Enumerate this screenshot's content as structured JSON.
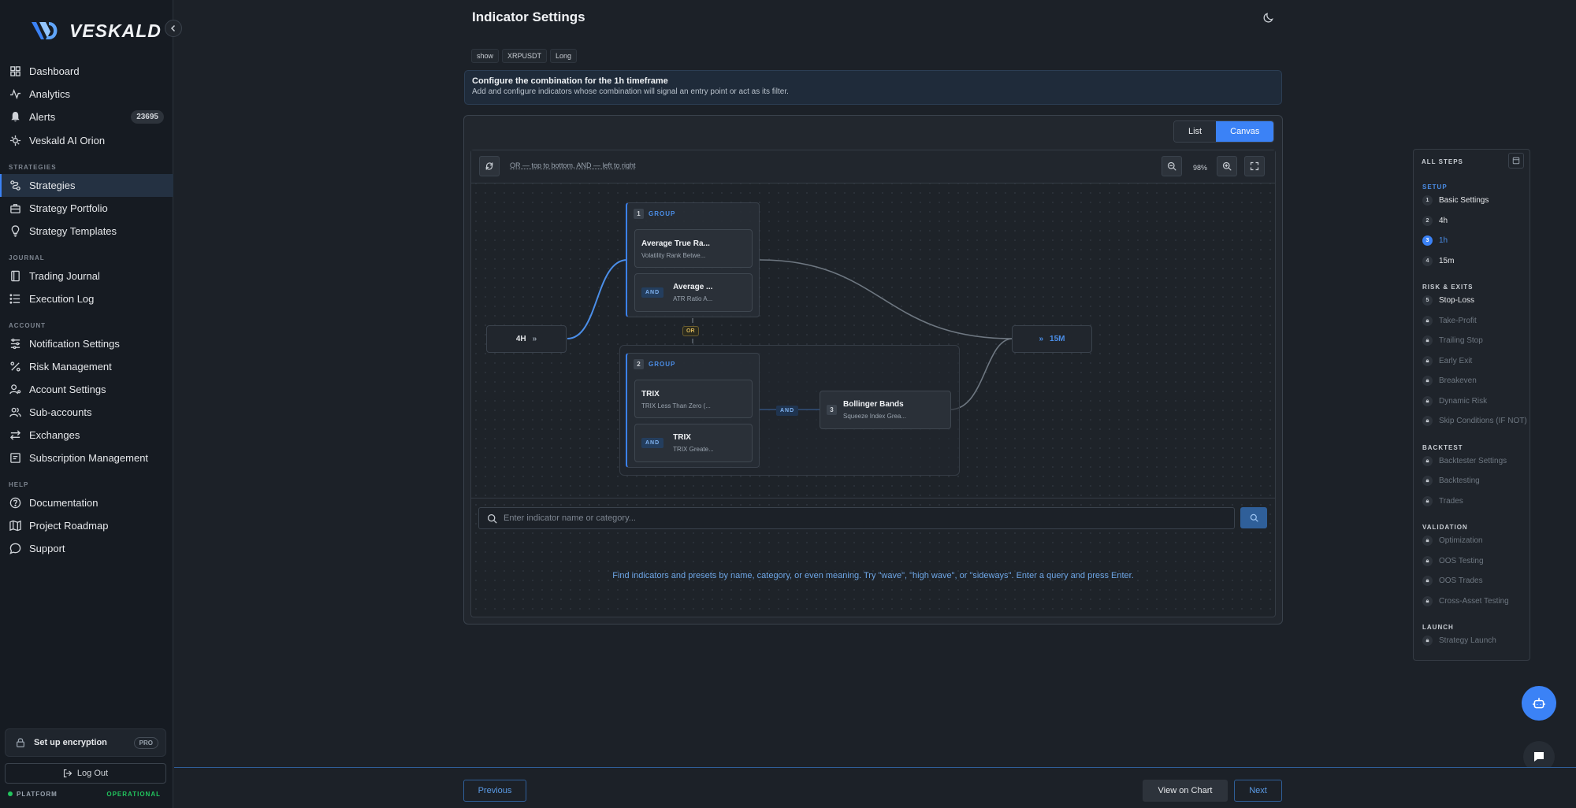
{
  "brand": {
    "name": "VESKALD"
  },
  "sidebar": {
    "items": [
      {
        "label": "Dashboard",
        "icon": "dashboard-icon"
      },
      {
        "label": "Analytics",
        "icon": "analytics-icon"
      },
      {
        "label": "Alerts",
        "icon": "bell-icon",
        "badge": "23695"
      },
      {
        "label": "Veskald AI Orion",
        "icon": "ai-icon"
      }
    ],
    "sections": {
      "strategies": {
        "label": "STRATEGIES",
        "items": [
          "Strategies",
          "Strategy Portfolio",
          "Strategy Templates"
        ]
      },
      "journal": {
        "label": "JOURNAL",
        "items": [
          "Trading Journal",
          "Execution Log"
        ]
      },
      "account": {
        "label": "ACCOUNT",
        "items": [
          "Notification Settings",
          "Risk Management",
          "Account Settings",
          "Sub-accounts",
          "Exchanges",
          "Subscription Management"
        ]
      },
      "help": {
        "label": "HELP",
        "items": [
          "Documentation",
          "Project Roadmap",
          "Support"
        ]
      }
    },
    "encryption": {
      "label": "Set up encryption",
      "tag": "PRO"
    },
    "logout": "Log Out",
    "platform": {
      "label": "PLATFORM",
      "status": "OPERATIONAL",
      "status_color": "#22c55e"
    }
  },
  "header": {
    "title": "Indicator Settings"
  },
  "tags": [
    "show",
    "XRPUSDT",
    "Long"
  ],
  "info": {
    "title": "Configure the combination for the 1h timeframe",
    "subtitle": "Add and configure indicators whose combination will signal an entry point or act as its filter."
  },
  "view_toggle": {
    "list": "List",
    "canvas": "Canvas",
    "selected": "Canvas"
  },
  "canvas": {
    "hint": "OR — top to bottom, AND — left to right",
    "zoom": "98%",
    "source_node": "4H",
    "target_node": "15M",
    "or_label": "OR",
    "groups": [
      {
        "num": "1",
        "label": "GROUP",
        "cards": [
          {
            "name": "Average True Ra...",
            "sub": "Volatility Rank Betwe..."
          },
          {
            "chip": "AND",
            "name": "Average ...",
            "sub": "ATR Ratio A..."
          }
        ]
      },
      {
        "num": "2",
        "label": "GROUP",
        "cards": [
          {
            "name": "TRIX",
            "sub": "TRIX Less Than Zero (..."
          },
          {
            "chip": "AND",
            "name": "TRIX",
            "sub": "TRIX Greate..."
          }
        ],
        "and_label": "AND",
        "linked": {
          "num": "3",
          "name": "Bollinger Bands",
          "sub": "Squeeze Index Grea..."
        }
      }
    ]
  },
  "search": {
    "placeholder": "Enter indicator name or category...",
    "help": "Find indicators and presets by name, category, or even meaning. Try \"wave\", \"high wave\", or \"sideways\". Enter a query and press Enter."
  },
  "steps": {
    "title": "ALL STEPS",
    "setup": {
      "label": "SETUP",
      "items": [
        {
          "n": "1",
          "label": "Basic Settings"
        },
        {
          "n": "2",
          "label": "4h"
        },
        {
          "n": "3",
          "label": "1h"
        },
        {
          "n": "4",
          "label": "15m"
        }
      ]
    },
    "risk": {
      "label": "RISK & EXITS",
      "items": [
        {
          "n": "5",
          "label": "Stop-Loss"
        },
        {
          "label": "Take-Profit"
        },
        {
          "label": "Trailing Stop"
        },
        {
          "label": "Early Exit"
        },
        {
          "label": "Breakeven"
        },
        {
          "label": "Dynamic Risk"
        },
        {
          "label": "Skip Conditions (IF NOT)"
        }
      ]
    },
    "backtest": {
      "label": "BACKTEST",
      "items": [
        "Backtester Settings",
        "Backtesting",
        "Trades"
      ]
    },
    "validation": {
      "label": "VALIDATION",
      "items": [
        "Optimization",
        "OOS Testing",
        "OOS Trades",
        "Cross-Asset Testing"
      ]
    },
    "launch": {
      "label": "LAUNCH",
      "items": [
        "Strategy Launch"
      ]
    }
  },
  "footer": {
    "previous": "Previous",
    "view_chart": "View on Chart",
    "next": "Next"
  },
  "colors": {
    "accent": "#3b82f6",
    "background": "#1c2128",
    "sidebar": "#161b22"
  }
}
